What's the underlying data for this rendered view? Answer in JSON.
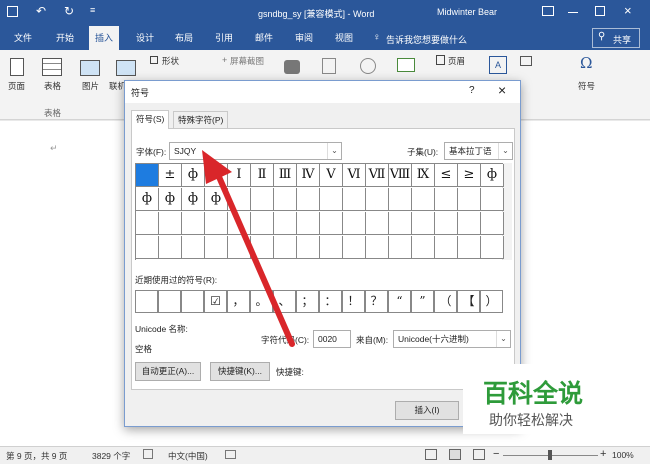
{
  "titlebar": {
    "doc_title": "gsndbg_sy [兼容模式] - Word",
    "user": "Midwinter Bear",
    "bg_color": "#2b579a"
  },
  "ribbon_tabs": [
    "文件",
    "开始",
    "插入",
    "设计",
    "布局",
    "引用",
    "邮件",
    "审阅",
    "视图"
  ],
  "active_tab": "插入",
  "tellme": "告诉我您想要做什么",
  "share": "共享",
  "ribbon": {
    "pages": "页面",
    "table": "表格",
    "table_group": "表格",
    "picture": "图片",
    "online": "联机",
    "shapes": "形状",
    "screenshot": "屏幕截图",
    "header": "页眉",
    "textbox": "文本框",
    "symbol": "符号"
  },
  "dialog": {
    "title": "符号",
    "help": "?",
    "close": "×",
    "tabs": [
      "符号(S)",
      "特殊字符(P)"
    ],
    "font_label": "字体(F):",
    "font_value": "SJQY",
    "subset_label": "子集(U):",
    "subset_value": "基本拉丁语",
    "grid_row1": [
      "",
      "±",
      "ф",
      "",
      "Ⅰ",
      "Ⅱ",
      "Ⅲ",
      "Ⅳ",
      "Ⅴ",
      "Ⅵ",
      "Ⅶ",
      "Ⅷ",
      "Ⅸ",
      "≤",
      "≥",
      "ф"
    ],
    "grid_row2": [
      "ф",
      "ф",
      "ф",
      "ф"
    ],
    "recent_label": "近期使用过的符号(R):",
    "recent": [
      "",
      "",
      "",
      "☑",
      "，",
      "。",
      "、",
      "；",
      "：",
      "！",
      "？",
      "“",
      "”",
      "（",
      "【",
      "）"
    ],
    "unicode_name_label": "Unicode 名称:",
    "unicode_name": "空格",
    "char_code_label": "字符代码(C):",
    "char_code": "0020",
    "from_label": "来自(M):",
    "from_value": "Unicode(十六进制)",
    "autocorrect": "自动更正(A)...",
    "shortcut_key": "快捷键(K)...",
    "shortcut_label": "快捷键:",
    "insert": "插入(I)",
    "accent": "#1e7ce0"
  },
  "status": {
    "page": "第 9 页，共 9 页",
    "words": "3829 个字",
    "lang": "中文(中国)",
    "zoom": "100%"
  },
  "watermark": {
    "title": "百科全说",
    "subtitle": "助你轻松解决"
  },
  "arrow_color": "#d9262a"
}
